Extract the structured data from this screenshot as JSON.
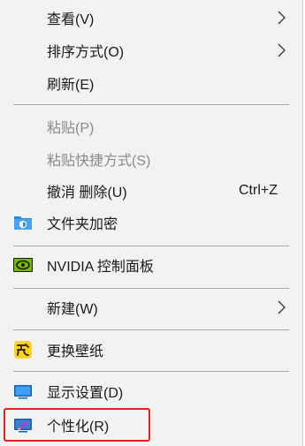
{
  "menu": {
    "view": {
      "label": "查看(V)",
      "has_submenu": true
    },
    "sort_by": {
      "label": "排序方式(O)",
      "has_submenu": true
    },
    "refresh": {
      "label": "刷新(E)"
    },
    "paste": {
      "label": "粘贴(P)",
      "disabled": true
    },
    "paste_shortcut": {
      "label": "粘贴快捷方式(S)",
      "disabled": true
    },
    "undo_delete": {
      "label": "撤消 删除(U)",
      "shortcut": "Ctrl+Z"
    },
    "folder_encrypt": {
      "label": "文件夹加密",
      "icon": "shield-folder-icon"
    },
    "nvidia": {
      "label": "NVIDIA 控制面板",
      "icon": "nvidia-icon"
    },
    "new": {
      "label": "新建(W)",
      "has_submenu": true
    },
    "change_wallpaper": {
      "label": "更换壁纸",
      "icon": "wallpaper-app-icon"
    },
    "display_settings": {
      "label": "显示设置(D)",
      "icon": "monitor-icon"
    },
    "personalize": {
      "label": "个性化(R)",
      "icon": "personalize-icon",
      "highlighted": true
    }
  },
  "colors": {
    "menu_bg": "#f2f2f2",
    "text": "#1a1a1a",
    "disabled_text": "#8a8a8a",
    "highlight_border": "#e0231d"
  }
}
